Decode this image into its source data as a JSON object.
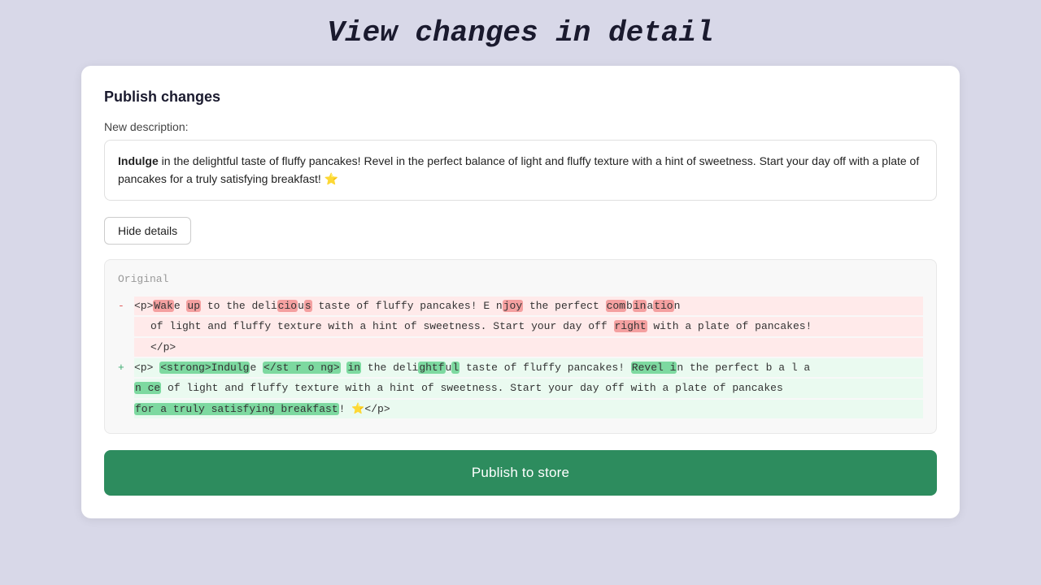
{
  "page": {
    "title": "View changes in detail"
  },
  "card": {
    "heading": "Publish changes",
    "description_label": "New description:",
    "description_text_bold": "Indulge",
    "description_text_rest": " in the delightful taste of fluffy pancakes! Revel in the perfect balance of light and fluffy texture with a hint of sweetness. Start your day off with a plate of pancakes for a truly satisfying breakfast! ⭐",
    "hide_button_label": "Hide details",
    "diff_original_label": "Original",
    "publish_button_label": "Publish to store"
  }
}
